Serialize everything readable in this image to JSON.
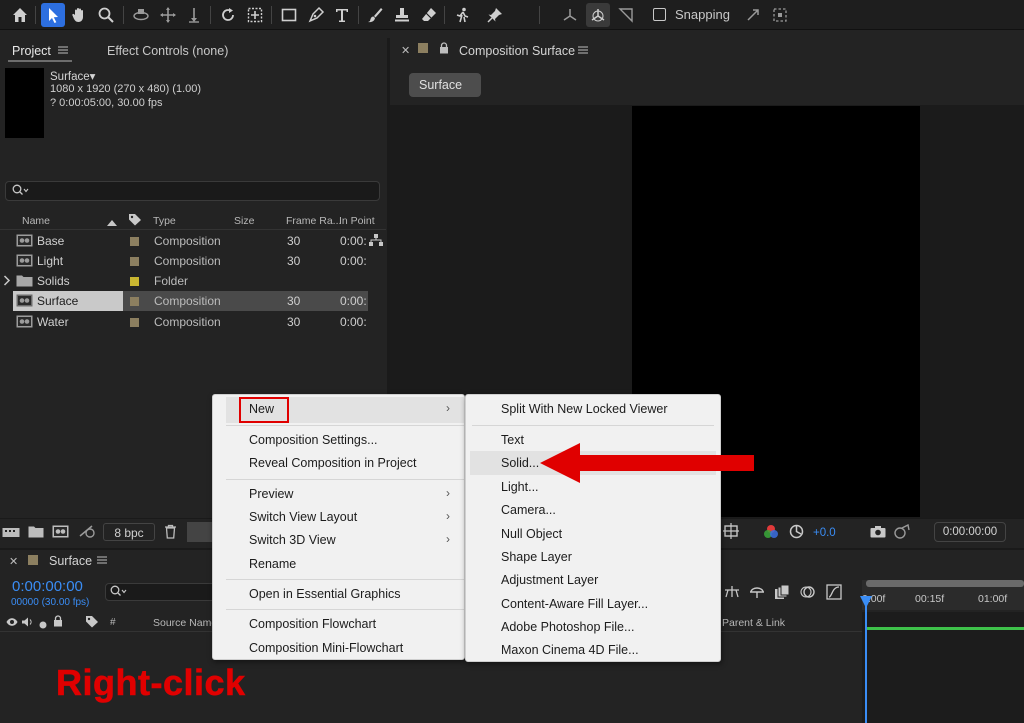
{
  "toolbar": {
    "snapping_label": "Snapping"
  },
  "project_panel": {
    "tab_project": "Project",
    "tab_effect_controls": "Effect Controls (none)",
    "selected_comp": {
      "name": "Surface▾",
      "dimensions": "1080 x 1920  (270 x 480) (1.00)",
      "duration": "? 0:00:05:00, 30.00 fps"
    },
    "columns": {
      "name": "Name",
      "type": "Type",
      "size": "Size",
      "frame_rate": "Frame Ra...",
      "in_point": "In Point"
    },
    "items": [
      {
        "name": "Base",
        "type": "Composition",
        "frame_rate": "30",
        "in_point": "0:00:",
        "swatch": "#8c7f60",
        "kind": "comp"
      },
      {
        "name": "Light",
        "type": "Composition",
        "frame_rate": "30",
        "in_point": "0:00:",
        "swatch": "#8c7f60",
        "kind": "comp"
      },
      {
        "name": "Solids",
        "type": "Folder",
        "frame_rate": "",
        "in_point": "",
        "swatch": "#c9b631",
        "kind": "folder"
      },
      {
        "name": "Surface",
        "type": "Composition",
        "frame_rate": "30",
        "in_point": "0:00:",
        "swatch": "#8c7f60",
        "kind": "comp",
        "selected": true
      },
      {
        "name": "Water",
        "type": "Composition",
        "frame_rate": "30",
        "in_point": "0:00:",
        "swatch": "#8c7f60",
        "kind": "comp"
      }
    ],
    "bpc_label": "8 bpc"
  },
  "viewer": {
    "panel_title": "Composition Surface",
    "active_tab": "Surface",
    "exposure": "+0.0",
    "current_time": "0:00:00:00"
  },
  "timeline": {
    "comp_name": "Surface",
    "timecode": "0:00:00:00",
    "frames": "00000 (30.00 fps)",
    "col_hash": "#",
    "col_source_name": "Source Name",
    "col_parent": "Parent & Link",
    "ticks": [
      "0:00f",
      "00:15f",
      "01:00f"
    ]
  },
  "context_menu": {
    "items": [
      {
        "label": "New",
        "submenu": true
      },
      {
        "label": "Composition Settings...",
        "submenu": false
      },
      {
        "label": "Reveal Composition in Project",
        "submenu": false
      },
      {
        "label": "Preview",
        "submenu": true
      },
      {
        "label": "Switch View Layout",
        "submenu": true
      },
      {
        "label": "Switch 3D View",
        "submenu": true
      },
      {
        "label": "Rename",
        "submenu": false
      },
      {
        "label": "Open in Essential Graphics",
        "submenu": false
      },
      {
        "label": "Composition Flowchart",
        "submenu": false
      },
      {
        "label": "Composition Mini-Flowchart",
        "submenu": false
      }
    ]
  },
  "new_submenu": {
    "items": [
      "Split With New Locked Viewer",
      "Text",
      "Solid...",
      "Light...",
      "Camera...",
      "Null Object",
      "Shape Layer",
      "Adjustment Layer",
      "Content-Aware Fill Layer...",
      "Adobe Photoshop File...",
      "Maxon Cinema 4D File..."
    ]
  },
  "annotation": {
    "label": "Right-click",
    "color": "#e00000"
  },
  "colors": {
    "accent_blue": "#2d6fe0",
    "timecode_blue": "#3a8df5",
    "workarea_green": "#3ec24a",
    "comp_swatch": "#8c7f60",
    "folder_swatch": "#c9b631"
  }
}
